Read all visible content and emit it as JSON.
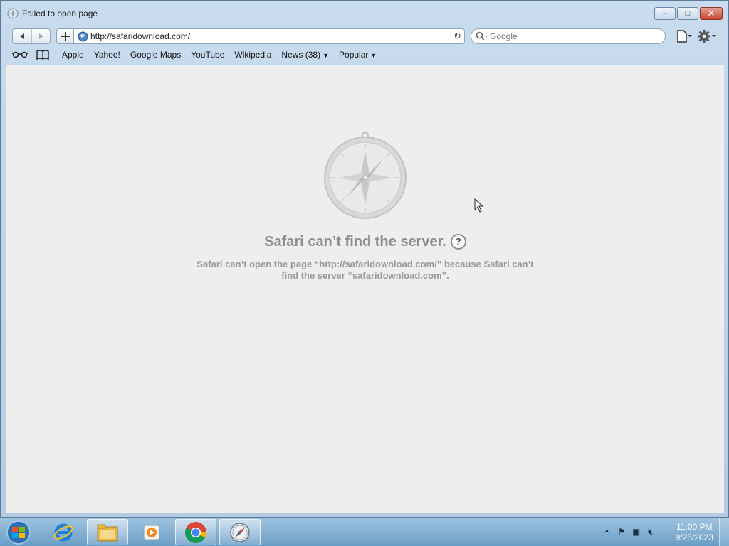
{
  "window": {
    "title": "Failed to open page",
    "controls": {
      "minimize": "–",
      "maximize": "□",
      "close": "✕"
    }
  },
  "toolbar": {
    "back_icon": "back-arrow-icon",
    "forward_icon": "forward-arrow-icon",
    "add_icon": "plus-icon",
    "url": "http://safaridownload.com/",
    "search_placeholder": "Google"
  },
  "bookmarks": {
    "items": [
      {
        "label": "Apple"
      },
      {
        "label": "Yahoo!"
      },
      {
        "label": "Google Maps"
      },
      {
        "label": "YouTube"
      },
      {
        "label": "Wikipedia"
      },
      {
        "label": "News (38)",
        "dropdown": true
      },
      {
        "label": "Popular",
        "dropdown": true
      }
    ]
  },
  "error": {
    "title": "Safari can’t find the server.",
    "help": "?",
    "message": "Safari can’t open the page “http://safaridownload.com/” because Safari can’t find the server “safaridownload.com”."
  },
  "taskbar": {
    "apps": [
      "internet-explorer",
      "windows-explorer",
      "media-player",
      "chrome",
      "safari"
    ],
    "clock_time": "11:00 PM",
    "clock_date": "9/25/2023"
  },
  "colors": {
    "content_bg": "#eeeeee",
    "error_text": "#8d8d8d",
    "taskbar": "#6a9ec6",
    "close_button": "#c7452d"
  }
}
